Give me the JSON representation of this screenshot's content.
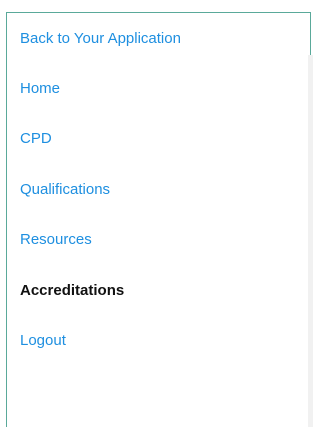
{
  "nav": {
    "items": [
      {
        "label": "Back to Your Application",
        "active": false
      },
      {
        "label": "Home",
        "active": false
      },
      {
        "label": "CPD",
        "active": false
      },
      {
        "label": "Qualifications",
        "active": false
      },
      {
        "label": "Resources",
        "active": false
      },
      {
        "label": "Accreditations",
        "active": true
      },
      {
        "label": "Logout",
        "active": false
      }
    ]
  },
  "colors": {
    "link": "#1e8fe0",
    "active_text": "#111111",
    "panel_border": "#5aa99a"
  }
}
